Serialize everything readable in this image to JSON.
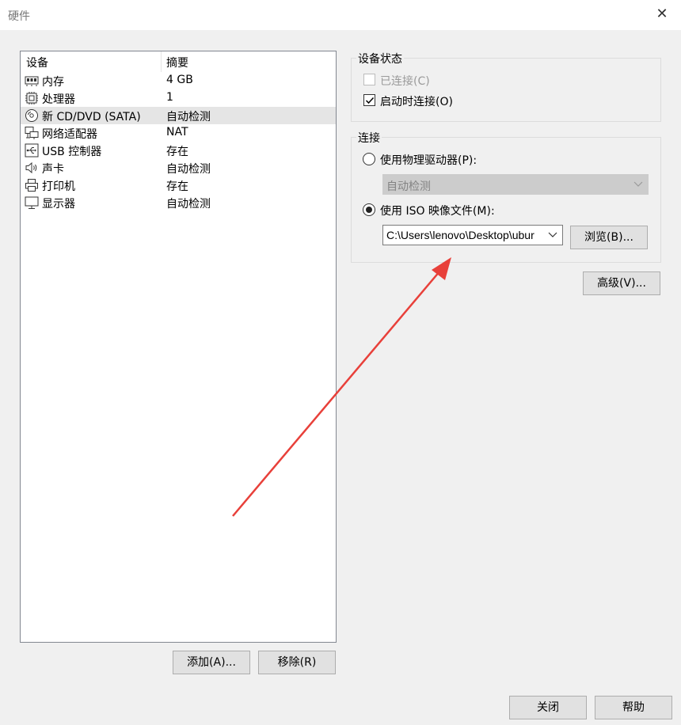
{
  "window": {
    "title": "硬件",
    "close_glyph": "✕"
  },
  "device_list": {
    "headers": {
      "device": "设备",
      "summary": "摘要"
    },
    "rows": [
      {
        "icon": "memory-icon",
        "name": "内存",
        "summary": "4 GB"
      },
      {
        "icon": "processor-icon",
        "name": "处理器",
        "summary": "1"
      },
      {
        "icon": "cd-dvd-icon",
        "name": "新 CD/DVD (SATA)",
        "summary": "自动检测",
        "selected": true
      },
      {
        "icon": "network-adapter-icon",
        "name": "网络适配器",
        "summary": "NAT"
      },
      {
        "icon": "usb-icon",
        "name": "USB 控制器",
        "summary": "存在"
      },
      {
        "icon": "sound-card-icon",
        "name": "声卡",
        "summary": "自动检测"
      },
      {
        "icon": "printer-icon",
        "name": "打印机",
        "summary": "存在"
      },
      {
        "icon": "display-icon",
        "name": "显示器",
        "summary": "自动检测"
      }
    ]
  },
  "list_buttons": {
    "add": "添加(A)...",
    "remove": "移除(R)"
  },
  "device_status": {
    "label": "设备状态",
    "connected": {
      "label": "已连接(C)",
      "checked": false,
      "disabled": true
    },
    "connect_on_start": {
      "label": "启动时连接(O)",
      "checked": true
    }
  },
  "connection": {
    "label": "连接",
    "physical": {
      "label": "使用物理驱动器(P):",
      "selected": false
    },
    "physical_select": {
      "value": "自动检测"
    },
    "iso": {
      "label": "使用 ISO 映像文件(M):",
      "selected": true
    },
    "iso_path": "C:\\Users\\lenovo\\Desktop\\ubur",
    "browse": "浏览(B)..."
  },
  "advanced": "高级(V)...",
  "footer": {
    "close": "关闭",
    "help": "帮助"
  },
  "colors": {
    "annotation_arrow": "#e8403a",
    "selected_row": "#e5e5e5"
  }
}
